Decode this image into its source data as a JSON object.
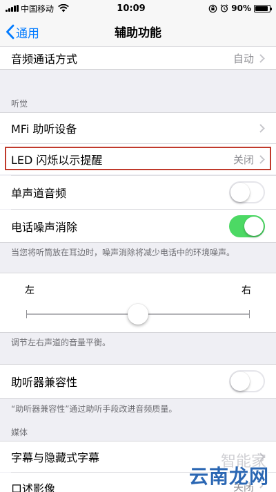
{
  "status_bar": {
    "carrier": "中国移动",
    "time": "10:09",
    "battery": "90%",
    "battery_level": 0.9
  },
  "nav": {
    "back_label": "通用",
    "title": "辅助功能"
  },
  "rows": {
    "audio_routing": {
      "label": "音频通话方式",
      "value": "自动"
    },
    "mfi_hearing": {
      "label": "MFi 助听设备"
    },
    "led_flash": {
      "label": "LED 闪烁以示提醒",
      "value": "关闭"
    },
    "mono_audio": {
      "label": "单声道音频",
      "toggle": false
    },
    "noise_cancel": {
      "label": "电话噪声消除",
      "toggle": true
    },
    "hearing_aid_compat": {
      "label": "助听器兼容性",
      "toggle": false
    },
    "subtitles": {
      "label": "字幕与隐藏式字幕"
    },
    "audio_desc": {
      "label": "口述影像",
      "value": "关闭"
    }
  },
  "sections": {
    "hearing": "听觉",
    "media": "媒体"
  },
  "footers": {
    "noise_cancel": "当您将听筒放在耳边时，噪声消除将减少电话中的环境噪声。",
    "balance": "调节左右声道的音量平衡。",
    "hearing_aid": "“助听器兼容性”通过助听手段改进音频质量。"
  },
  "balance_slider": {
    "left_label": "左",
    "right_label": "右",
    "value": 0.5
  },
  "watermark": {
    "text": "云南龙网",
    "faint_text": "智能家"
  },
  "colors": {
    "accent": "#007aff",
    "toggle_on": "#4cd964",
    "highlight": "#c0392b"
  }
}
